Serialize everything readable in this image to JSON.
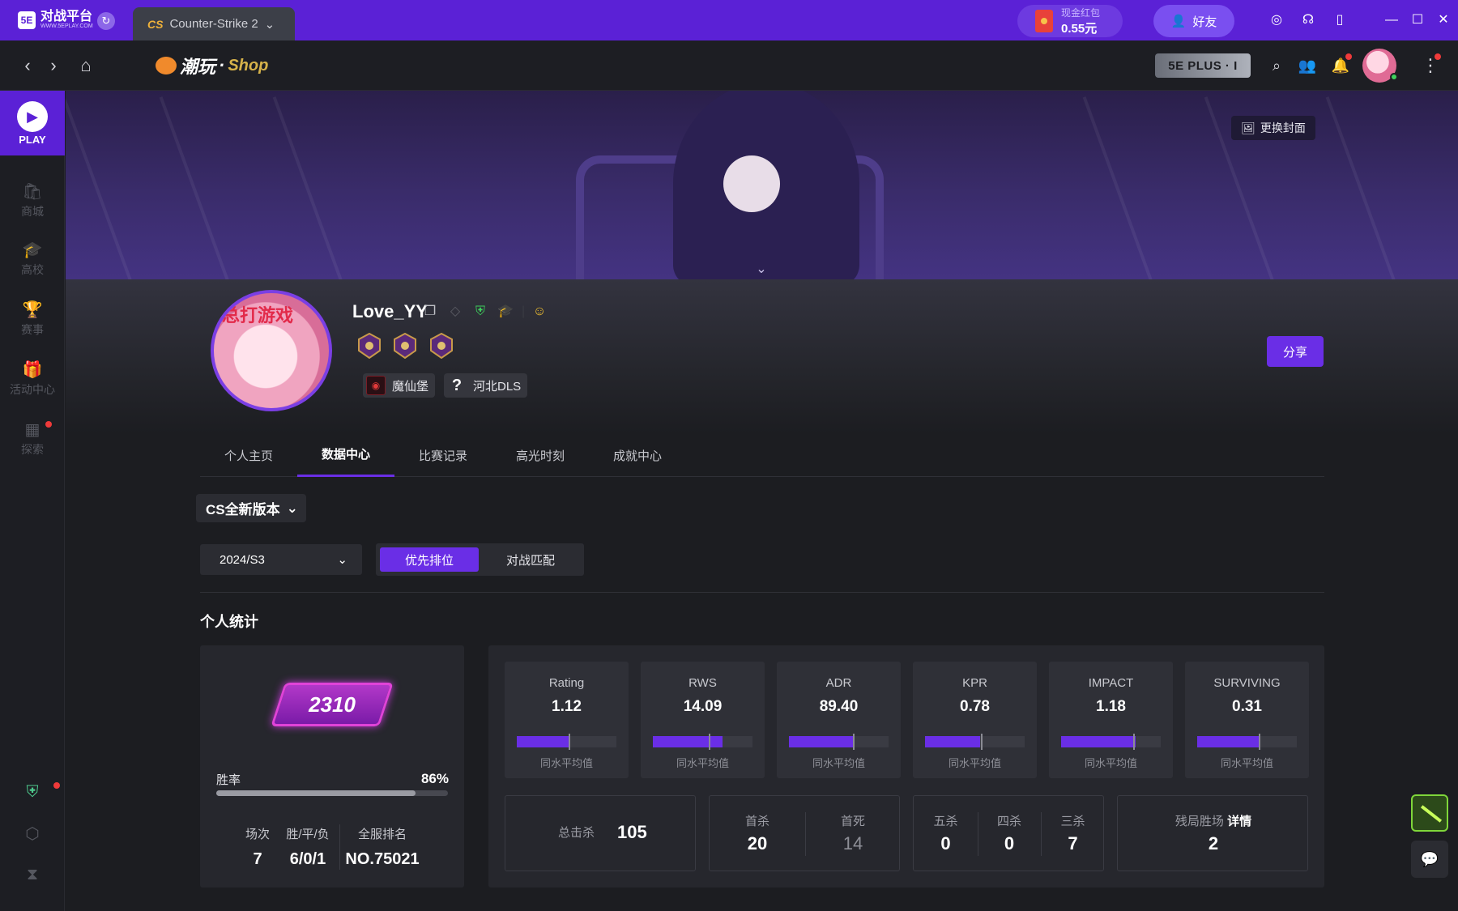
{
  "app": {
    "logo_text": "对战平台",
    "logo_sub": "WWW.5EPLAY.COM",
    "logo_badge": "5E"
  },
  "titlebar": {
    "game_tab": "Counter-Strike 2",
    "game_tab_short": "CS",
    "redpacket_label": "现金红包",
    "redpacket_value": "0.55元",
    "friends_label": "好友"
  },
  "nav": {
    "brand_text": "潮玩",
    "brand_dot": "·",
    "brand_shop": "Shop",
    "plus_badge": "5E PLUS · I"
  },
  "sidebar": {
    "play_label": "PLAY",
    "items": [
      {
        "label": "商城",
        "icon": "bag-icon"
      },
      {
        "label": "高校",
        "icon": "graduation-cap-icon"
      },
      {
        "label": "赛事",
        "icon": "trophy-icon"
      },
      {
        "label": "活动中心",
        "icon": "gift-icon"
      },
      {
        "label": "探索",
        "icon": "grid-icon"
      }
    ]
  },
  "banner": {
    "change_cover_label": "更换封面"
  },
  "profile": {
    "username": "Love_YY",
    "avatar_caption": "总打游戏",
    "tags": [
      {
        "label": "魔仙堡"
      },
      {
        "label": "河北DLS",
        "mark": "?"
      }
    ],
    "share_label": "分享"
  },
  "tabs": [
    {
      "label": "个人主页",
      "active": false
    },
    {
      "label": "数据中心",
      "active": true
    },
    {
      "label": "比赛记录",
      "active": false
    },
    {
      "label": "高光时刻",
      "active": false
    },
    {
      "label": "成就中心",
      "active": false
    }
  ],
  "filters": {
    "version": "CS全新版本",
    "season": "2024/S3",
    "modes": [
      {
        "label": "优先排位",
        "active": true
      },
      {
        "label": "对战匹配",
        "active": false
      }
    ]
  },
  "personal_stats": {
    "section_title": "个人统计",
    "rank_score": "2310",
    "winrate_label": "胜率",
    "winrate_value": "86%",
    "winrate_fraction": 0.86,
    "matches_label": "场次",
    "matches_value": "7",
    "wdl_label": "胜/平/负",
    "wdl_value": "6/0/1",
    "rank_label": "全服排名",
    "rank_value": "NO.75021"
  },
  "metrics": [
    {
      "name": "Rating",
      "value": "1.12",
      "fill": 0.52,
      "avg": 0.52,
      "avg_label": "同水平均值"
    },
    {
      "name": "RWS",
      "value": "14.09",
      "fill": 0.7,
      "avg": 0.56,
      "avg_label": "同水平均值"
    },
    {
      "name": "ADR",
      "value": "89.40",
      "fill": 0.64,
      "avg": 0.64,
      "avg_label": "同水平均值"
    },
    {
      "name": "KPR",
      "value": "0.78",
      "fill": 0.55,
      "avg": 0.56,
      "avg_label": "同水平均值"
    },
    {
      "name": "IMPACT",
      "value": "1.18",
      "fill": 0.75,
      "avg": 0.72,
      "avg_label": "同水平均值"
    },
    {
      "name": "SURVIVING",
      "value": "0.31",
      "fill": 0.62,
      "avg": 0.62,
      "avg_label": "同水平均值"
    }
  ],
  "kills": {
    "total_label": "总击杀",
    "total_value": "105",
    "first_kill_label": "首杀",
    "first_kill_value": "20",
    "first_death_label": "首死",
    "first_death_value": "14",
    "penta_label": "五杀",
    "penta_value": "0",
    "quad_label": "四杀",
    "quad_value": "0",
    "triple_label": "三杀",
    "triple_value": "7",
    "clutch_label": "残局胜场",
    "clutch_detail": "详情",
    "clutch_value": "2"
  },
  "colors": {
    "accent": "#6a2ee6",
    "titlebar": "#5b21d6",
    "background": "#1c1d21",
    "panel": "#26272d"
  }
}
